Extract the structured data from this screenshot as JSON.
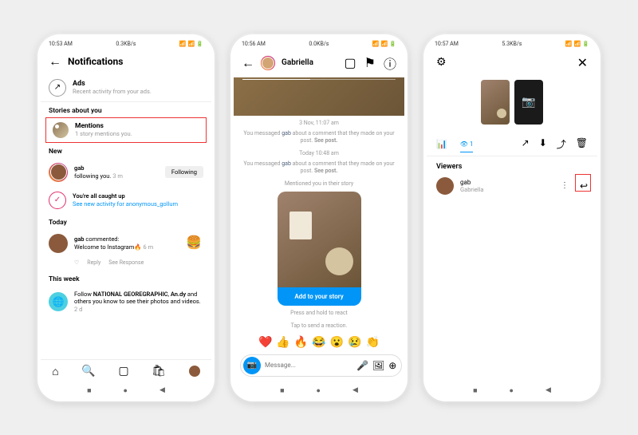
{
  "phone1": {
    "status": {
      "time": "10:53 AM",
      "data": "0.3KB/s",
      "wifi": "⊘"
    },
    "header": {
      "title": "Notifications"
    },
    "ads": {
      "title": "Ads",
      "sub": "Recent activity from your ads."
    },
    "sect_stories": "Stories about you",
    "mentions": {
      "title": "Mentions",
      "sub": "1 story mentions you."
    },
    "sect_new": "New",
    "gab": {
      "name": "gab",
      "action": "following you.",
      "time": "3 m",
      "btn": "Following"
    },
    "caught": {
      "title": "You're all caught up",
      "link": "See new activity for anonymous_gollum"
    },
    "sect_today": "Today",
    "comment": {
      "name": "gab",
      "action": "commented:",
      "body": "Welcome to Instagram🔥",
      "time": "6 m"
    },
    "reply": "Reply",
    "see": "See Response",
    "sect_week": "This week",
    "follow": {
      "text1": "Follow ",
      "b1": "NATIONAL GEOREGRAPHIC",
      "b2": "An.dy",
      "text2": " and others you know to see their photos and videos.",
      "time": "2 d"
    }
  },
  "phone2": {
    "status": {
      "time": "10:56 AM",
      "data": "0.0KB/s"
    },
    "header": {
      "name": "Gabriella"
    },
    "ts1": "3 Nov, 11:07 am",
    "msg1a": "You messaged ",
    "msg1b": "gab",
    "msg1c": " about a comment that they made on your post. ",
    "msg1d": "See post.",
    "ts2": "Today 10:48 am",
    "mention": "Mentioned you in their story",
    "addstory": "Add to your story",
    "hold": "Press and hold to react",
    "tap": "Tap to send a reaction.",
    "placeholder": "Message..."
  },
  "phone3": {
    "status": {
      "time": "10:57 AM",
      "data": "5.3KB/s"
    },
    "eye": "👁",
    "count": "1",
    "viewers_h": "Viewers",
    "viewer": {
      "name": "gab",
      "sub": "Gabriella"
    }
  }
}
